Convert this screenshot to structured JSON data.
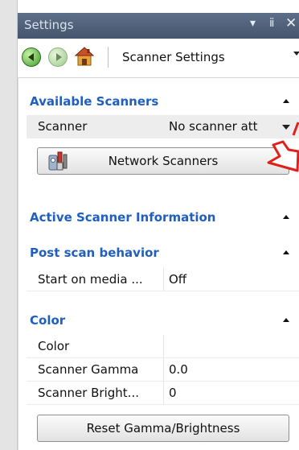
{
  "window": {
    "title": "Settings",
    "menu_glyph": "▾",
    "pin_glyph": "ⅱ",
    "close_glyph": "✕"
  },
  "toolbar": {
    "back_icon": "back-arrow-icon",
    "forward_icon": "forward-arrow-icon",
    "home_icon": "home-icon",
    "location": "Scanner Settings"
  },
  "sections": {
    "available_scanners": {
      "title": "Available Scanners",
      "scanner_label": "Scanner",
      "scanner_value": "No scanner att",
      "network_button": "Network Scanners"
    },
    "active_info": {
      "title": "Active Scanner Information"
    },
    "post_scan": {
      "title": "Post scan behavior",
      "start_label": "Start on media ...",
      "start_value": "Off"
    },
    "color": {
      "title": "Color",
      "rows": [
        {
          "label": "Color",
          "value": ""
        },
        {
          "label": "Scanner Gamma",
          "value": "0.0"
        },
        {
          "label": "Scanner Bright...",
          "value": "0"
        }
      ],
      "reset_button": "Reset Gamma/Brightness"
    }
  },
  "colors": {
    "titlebar": "#4f5e78",
    "section_header": "#1f5fbf",
    "annotation_arrow": "#e0201a"
  }
}
